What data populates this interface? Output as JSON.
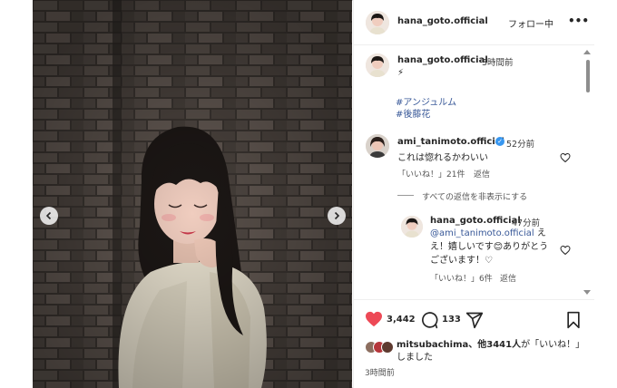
{
  "post": {
    "image_alt": "photo of a smiling woman in a lace cardigan against a brick wall",
    "prev_icon": "chevron-left-icon",
    "next_icon": "chevron-right-icon"
  },
  "header": {
    "username": "hana_goto.official",
    "follow_label": "フォロー中",
    "more_label": "•••"
  },
  "caption": {
    "username": "hana_goto.official",
    "time": "3時間前",
    "emoji": "⚡",
    "hashtags": [
      "#アンジュルム",
      "#後藤花"
    ]
  },
  "comments": [
    {
      "username": "ami_tanimoto.official",
      "verified": true,
      "time": "52分前",
      "text": "これは惚れるかわいい",
      "likes": "「いいね！」21件",
      "reply_label": "返信"
    }
  ],
  "hide_replies_label": "すべての返信を非表示にする",
  "replies": [
    {
      "username": "hana_goto.official",
      "time": "47分前",
      "mention": "@ami_tanimoto.official",
      "text_line": "ええ！嬉しいです😊ありがとうございます！♡",
      "likes": "「いいね！」6件",
      "reply_label": "返信"
    }
  ],
  "actions": {
    "like_count": "3,442",
    "comment_count": "133",
    "liked_by_user": "mitsubachima",
    "liked_by_rest": "、他3441人",
    "liked_by_suffix": "が「いいね！」しました",
    "posted_ago": "3時間前",
    "heart_color": "#ed4956"
  }
}
